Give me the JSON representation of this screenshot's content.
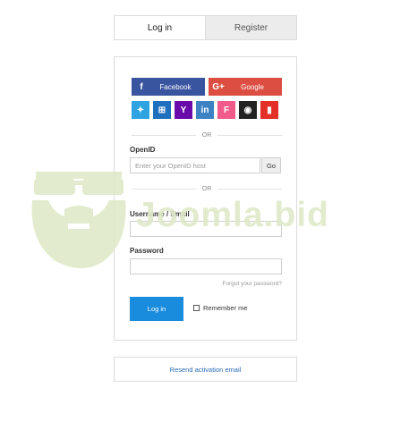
{
  "tabs": {
    "login": "Log in",
    "register": "Register"
  },
  "social": {
    "facebook": {
      "label": "Facebook",
      "glyph": "f",
      "color": "#3a559f"
    },
    "google": {
      "label": "Google",
      "glyph": "G+",
      "color": "#dc4e41"
    },
    "small": [
      {
        "name": "twitter-icon",
        "glyph": "✦",
        "color": "#2da4e1"
      },
      {
        "name": "windows-icon",
        "glyph": "⊞",
        "color": "#1e6fbd"
      },
      {
        "name": "yahoo-icon",
        "glyph": "Y",
        "color": "#6a0aab"
      },
      {
        "name": "linkedin-icon",
        "glyph": "in",
        "color": "#3d83c3"
      },
      {
        "name": "foursquare-icon",
        "glyph": "F",
        "color": "#f15b8b"
      },
      {
        "name": "github-icon",
        "glyph": "◉",
        "color": "#222222"
      },
      {
        "name": "stackexchange-icon",
        "glyph": "▮",
        "color": "#e32f25"
      }
    ]
  },
  "divider_text": "OR",
  "openid": {
    "label": "OpenID",
    "placeholder": "Enter your OpenID host",
    "go": "Go"
  },
  "username": {
    "label": "Username / Email"
  },
  "password": {
    "label": "Password",
    "forgot": "Forgot your password?"
  },
  "actions": {
    "login": "Log in",
    "remember": "Remember me"
  },
  "resend": "Resend activation email",
  "watermark": {
    "text": "Joomla.bid",
    "color": "#dfe9c8"
  }
}
